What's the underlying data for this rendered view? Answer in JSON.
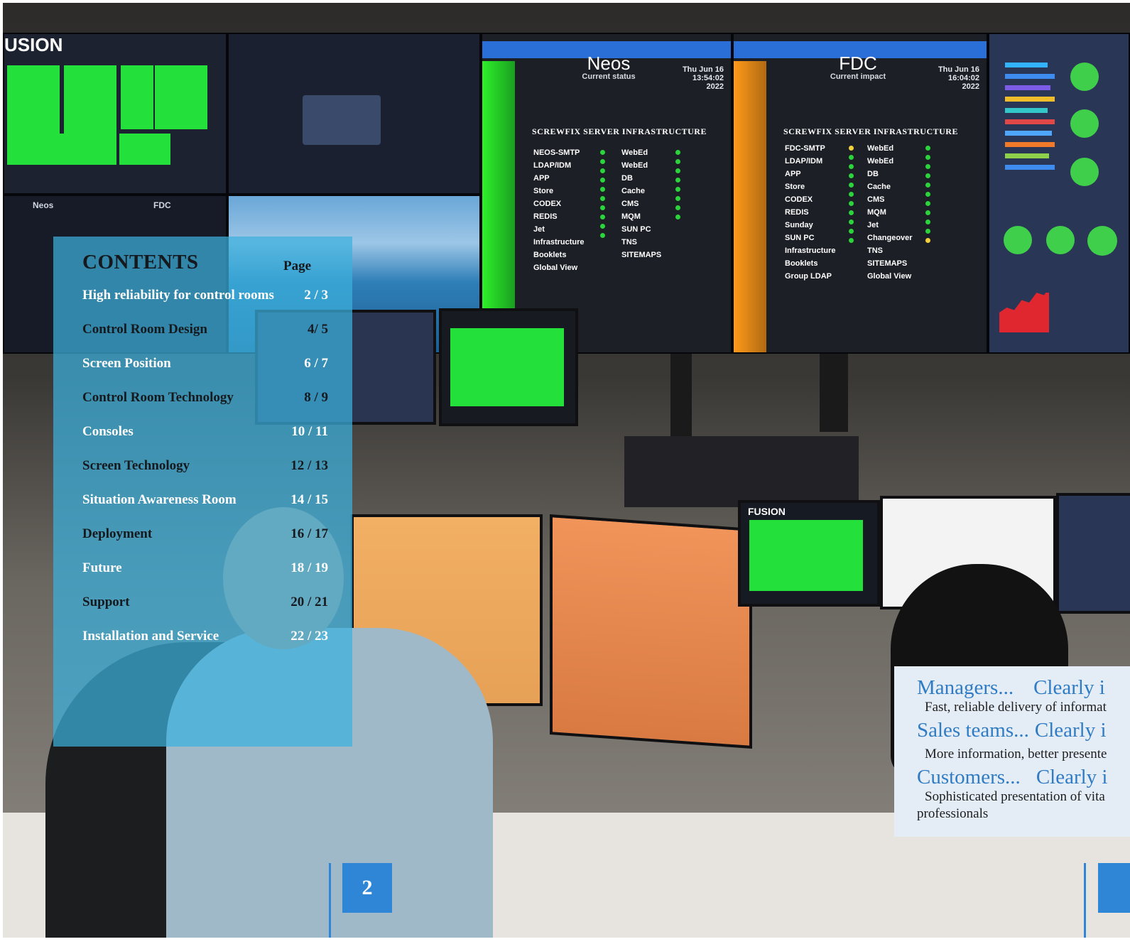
{
  "contents": {
    "title": "CONTENTS",
    "page_header": "Page",
    "items": [
      {
        "label": "High reliability for control rooms",
        "page": "2 / 3",
        "tone": "light"
      },
      {
        "label": "Control Room Design",
        "page": "4/ 5",
        "tone": "dark"
      },
      {
        "label": "Screen Position",
        "page": "6 / 7",
        "tone": "light"
      },
      {
        "label": "Control Room Technology",
        "page": "8 / 9",
        "tone": "dark"
      },
      {
        "label": "Consoles",
        "page": "10 / 11",
        "tone": "light"
      },
      {
        "label": "Screen Technology",
        "page": "12 / 13",
        "tone": "dark"
      },
      {
        "label": "Situation Awareness Room",
        "page": "14 / 15",
        "tone": "light"
      },
      {
        "label": "Deployment",
        "page": "16 / 17",
        "tone": "dark"
      },
      {
        "label": "Future",
        "page": "18 / 19",
        "tone": "light"
      },
      {
        "label": "Support",
        "page": "20 / 21",
        "tone": "dark"
      },
      {
        "label": "Installation and Service",
        "page": "22 / 23",
        "tone": "light"
      }
    ]
  },
  "info_box": {
    "managers_head": "Managers...",
    "managers_clearly": "Clearly i",
    "managers_text": "Fast, reliable delivery of informat",
    "sales_head": "Sales teams...",
    "sales_clearly": "Clearly i",
    "sales_text": "More information, better presente",
    "customers_head": "Customers...",
    "customers_clearly": "Clearly i",
    "customers_text_1": "Sophisticated presentation of vita",
    "customers_text_2": "professionals"
  },
  "page_number": "2",
  "photo_screens": {
    "fusion_logo": "USION",
    "fusion_logo_2": "FUSION",
    "neos_title": "Neos",
    "neos_subtitle": "Current status",
    "neos_date": "Thu Jun 16 13:54:02 2022",
    "neos_header": "SCREWFIX SERVER INFRASTRUCTURE",
    "neos_col1": [
      "NEOS-SMTP",
      "LDAP/IDM",
      "APP",
      "Store",
      "CODEX",
      "REDIS",
      "Jet",
      "Infrastructure",
      "Booklets",
      "Global View"
    ],
    "neos_col2": [
      "WebEd",
      "WebEd",
      "DB",
      "Cache",
      "CMS",
      "MQM",
      "SUN PC",
      "TNS",
      "SITEMAPS"
    ],
    "fdc_title": "FDC",
    "fdc_subtitle": "Current impact",
    "fdc_date": "Thu Jun 16 16:04:02 2022",
    "fdc_header": "SCREWFIX SERVER INFRASTRUCTURE",
    "fdc_col1": [
      "FDC-SMTP",
      "LDAP/IDM",
      "APP",
      "Store",
      "CODEX",
      "REDIS",
      "Sunday",
      "SUN PC",
      "Infrastructure",
      "Booklets",
      "Group LDAP"
    ],
    "fdc_col2": [
      "WebEd",
      "WebEd",
      "DB",
      "Cache",
      "CMS",
      "MQM",
      "Jet",
      "Changeover",
      "TNS",
      "SITEMAPS",
      "Global View"
    ],
    "mini_neos": "Neos",
    "mini_fdc": "FDC"
  },
  "colors": {
    "panel": "#3cb0dc",
    "accent_blue": "#2f86d6",
    "status_green": "#23e03a",
    "status_orange": "#ff9a1a"
  }
}
